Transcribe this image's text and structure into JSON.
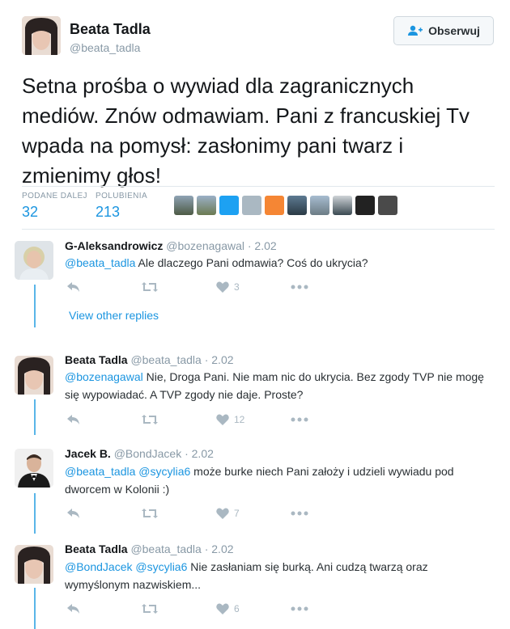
{
  "tweet": {
    "author_name": "Beata Tadla",
    "author_handle": "@beata_tadla",
    "follow_label": "Obserwuj",
    "text": "Setna prośba o wywiad dla zagranicznych mediów. Znów odmawiam. Pani z francuskiej Tv wpada na pomysł: zasłonimy pani twarz i zmienimy głos!",
    "retweets_label": "PODANE DALEJ",
    "retweets_count": "32",
    "likes_label": "POLUBIENIA",
    "likes_count": "213"
  },
  "replies": [
    {
      "name": "G-Aleksandrowicz",
      "handle": "@bozenagawal · 2.02",
      "mention": "@beata_tadla",
      "text": " Ale dlaczego Pani odmawia? Coś do ukrycia?",
      "likes": "3"
    },
    {
      "name": "Beata Tadla",
      "handle": "@beata_tadla · 2.02",
      "mention": "@bozenagawal",
      "text": " Nie, Droga Pani. Nie mam nic do ukrycia. Bez zgody TVP nie mogę się wypowiadać. A TVP zgody nie daje. Proste?",
      "likes": "12"
    },
    {
      "name": "Jacek B.",
      "handle": "@BondJacek · 2.02",
      "mention": "@beata_tadla @sycylia6",
      "text": " może burke niech Pani założy i udzieli wywiadu pod dworcem w Kolonii :)",
      "likes": "7"
    },
    {
      "name": "Beata Tadla",
      "handle": "@beata_tadla · 2.02",
      "mention": "@BondJacek @sycylia6",
      "text": " Nie zasłaniam się burką. Ani cudzą twarzą oraz wymyślonym nazwiskiem...",
      "likes": "6"
    }
  ],
  "view_other_replies": "View other replies",
  "colors": {
    "link": "#1b95e0",
    "thread": "#59b5e8",
    "muted": "#8899a6"
  }
}
